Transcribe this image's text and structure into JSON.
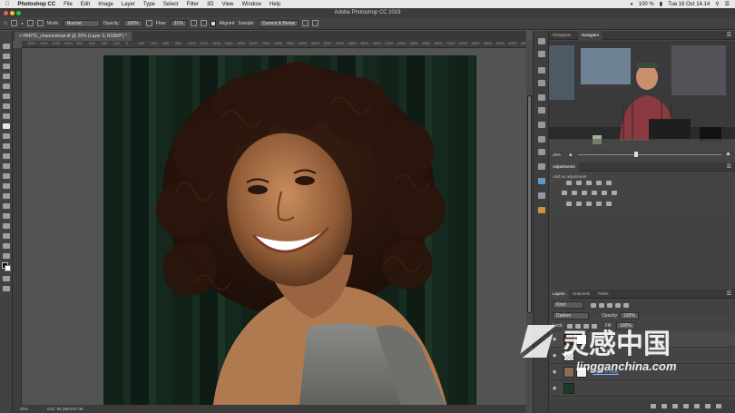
{
  "menubar": {
    "items": [
      "Photoshop CC",
      "File",
      "Edit",
      "Image",
      "Layer",
      "Type",
      "Select",
      "Filter",
      "3D",
      "View",
      "Window",
      "Help"
    ],
    "battery": "100 %",
    "clock": "Tue 16 Oct  14.14"
  },
  "window_title": "Adobe Photoshop CC 2019",
  "options": {
    "mode_label": "Mode:",
    "mode_value": "Normal",
    "opacity_label": "Opacity:",
    "opacity_value": "100%",
    "flow_label": "Flow:",
    "flow_value": "31%",
    "aligned_label": "Aligned",
    "sample_label": "Sample:",
    "sample_value": "Current & Below"
  },
  "document": {
    "tab_label": "PARTE_channelshair.tif @ 25% (Layer 3, RGB/8*) *",
    "zoom": "25%",
    "doc_info": "Doc: 85,3M/370,7M"
  },
  "ruler_ticks": [
    "1600",
    "1400",
    "1200",
    "1000",
    "800",
    "600",
    "400",
    "200",
    "0",
    "200",
    "400",
    "600",
    "800",
    "1000",
    "1200",
    "1400",
    "1600",
    "1800",
    "2000",
    "2200",
    "2400",
    "2600",
    "2800",
    "3000",
    "3200",
    "3400",
    "3600",
    "3800",
    "4000",
    "4200",
    "4400",
    "4600",
    "4800",
    "5000",
    "5200",
    "5400",
    "5600",
    "5800",
    "6000",
    "6200",
    "6400"
  ],
  "panels": {
    "nav_tabs": [
      "Histogram",
      "Navigator"
    ],
    "nav_zoom": "25%",
    "adjustments_title": "Adjustments",
    "adjustments_hint": "Add an adjustment",
    "layer_tabs": [
      "Layers",
      "Channels",
      "Paths"
    ],
    "layers_kind": "Kind",
    "blend_mode": "Darken",
    "opacity_label": "Opacity:",
    "opacity_value": "100%",
    "lock_label": "Lock:",
    "fill_label": "Fill:",
    "fill_value": "100%",
    "layer_name": "Layer 0 copy"
  },
  "watermark": {
    "cn": "灵感中国",
    "url": "lingganchina.com"
  },
  "colors": {
    "accent": "#2f7fd6",
    "menubar_bg": "#e8e8e8"
  }
}
